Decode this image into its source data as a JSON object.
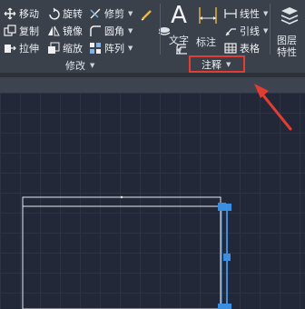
{
  "ribbon": {
    "modify_panel": {
      "row1": [
        {
          "label": "移动",
          "icon": "move-icon"
        },
        {
          "label": "旋转",
          "icon": "rotate-icon"
        },
        {
          "label": "修剪",
          "icon": "trim-icon"
        }
      ],
      "row2": [
        {
          "label": "复制",
          "icon": "copy-icon"
        },
        {
          "label": "镜像",
          "icon": "mirror-icon"
        },
        {
          "label": "圆角",
          "icon": "fillet-icon"
        }
      ],
      "row3": [
        {
          "label": "拉伸",
          "icon": "stretch-icon"
        },
        {
          "label": "缩放",
          "icon": "scale-icon"
        },
        {
          "label": "阵列",
          "icon": "array-icon"
        }
      ],
      "title": "修改"
    },
    "annotation_panel": {
      "text_big": "文字",
      "text_big_glyph": "A",
      "dimension": "标注",
      "linear": "线性",
      "leader": "引线",
      "table": "表格",
      "title": "注释"
    },
    "layers_panel": {
      "properties": "图层",
      "properties_line2": "特性"
    }
  },
  "colors": {
    "ribbon_bg": "#3b414b",
    "canvas_bg": "#222838",
    "highlight_red": "#e23d33",
    "grip_blue": "#3b8de0"
  }
}
